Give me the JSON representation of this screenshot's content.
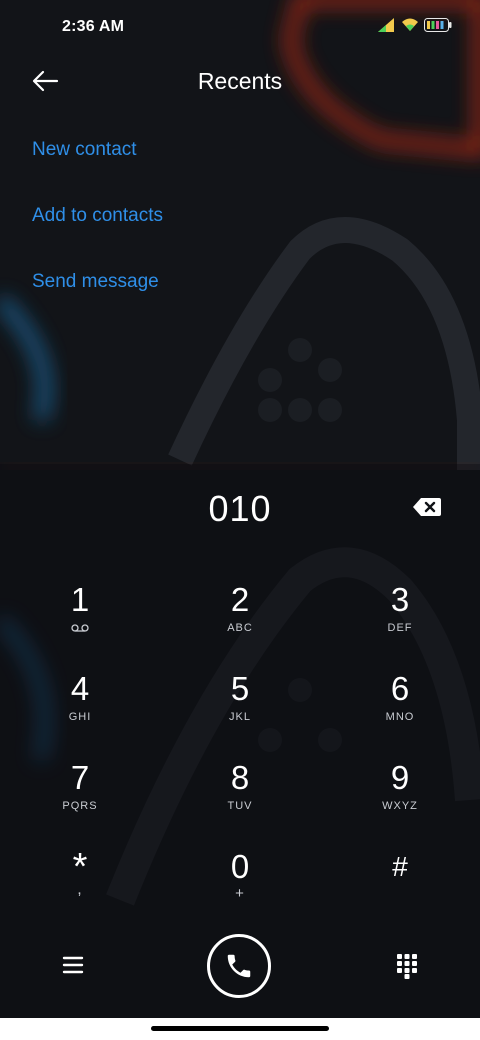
{
  "status_bar": {
    "time": "2:36 AM",
    "icons": [
      "signal-icon",
      "wifi-icon",
      "battery-icon"
    ]
  },
  "header": {
    "title": "Recents",
    "back_icon": "arrow-left-icon"
  },
  "actions": [
    {
      "label": "New contact"
    },
    {
      "label": "Add to contacts"
    },
    {
      "label": "Send message"
    }
  ],
  "dialer": {
    "number": "010",
    "keys": [
      {
        "digit": "1",
        "letters": ""
      },
      {
        "digit": "2",
        "letters": "ABC"
      },
      {
        "digit": "3",
        "letters": "DEF"
      },
      {
        "digit": "4",
        "letters": "GHI"
      },
      {
        "digit": "5",
        "letters": "JKL"
      },
      {
        "digit": "6",
        "letters": "MNO"
      },
      {
        "digit": "7",
        "letters": "PQRS"
      },
      {
        "digit": "8",
        "letters": "TUV"
      },
      {
        "digit": "9",
        "letters": "WXYZ"
      },
      {
        "digit": "*",
        "letters": ","
      },
      {
        "digit": "0",
        "letters": "+"
      },
      {
        "digit": "#",
        "letters": ""
      }
    ]
  },
  "colors": {
    "background": "#101216",
    "accent": "#2f8fe8",
    "glow_red": "#c0301e",
    "glow_blue": "#1f6fa8"
  }
}
